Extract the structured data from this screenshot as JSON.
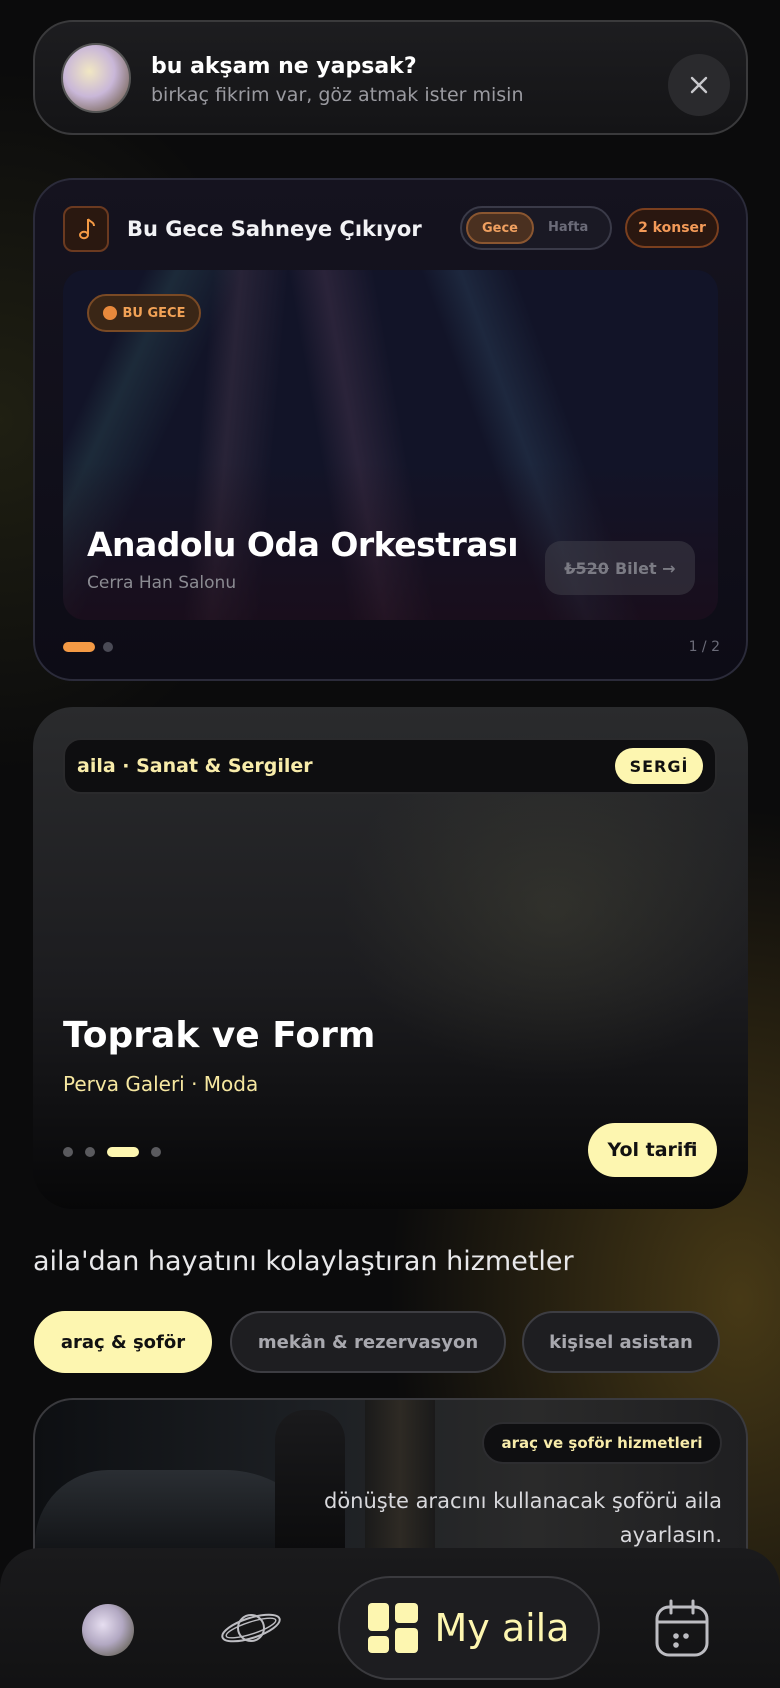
{
  "notification": {
    "title": "bu akşam ne yapsak?",
    "subtitle": "birkaç fikrim var, göz atmak ister misin",
    "close_icon": "close-icon"
  },
  "concert": {
    "title": "Bu Gece Sahneye Çıkıyor",
    "icon": "music-note-icon",
    "toggle": {
      "active": "Gece",
      "inactive": "Hafta"
    },
    "count_badge": "2 konser",
    "badge": "BU GECE",
    "event_name": "Anadolu Oda Orkestrası",
    "venue": "Cerra Han Salonu",
    "ticket_price": "₺520",
    "ticket_label": "Bilet →",
    "pager": "1 / 2",
    "accent": "#f49a45"
  },
  "exhibition": {
    "label": "aila · Sanat & Sergiler",
    "tag": "SERGİ",
    "title": "Toprak ve Form",
    "subtitle": "Perva Galeri · Moda",
    "action": "Yol tarifi",
    "accent": "#fdf6b0"
  },
  "services": {
    "heading": "aila'dan hayatını kolaylaştıran hizmetler",
    "chips": [
      "araç & şoför",
      "mekân & rezervasyon",
      "kişisel asistan"
    ],
    "active_chip": "araç & şoför",
    "card_tag": "araç ve şoför hizmetleri",
    "card_text": "dönüşte aracını kullanacak şoförü aila ayarlasın."
  },
  "bottom_nav": {
    "items": [
      "avatar",
      "planet-icon",
      "My aila",
      "calendar-icon"
    ],
    "center_label": "My aila"
  }
}
